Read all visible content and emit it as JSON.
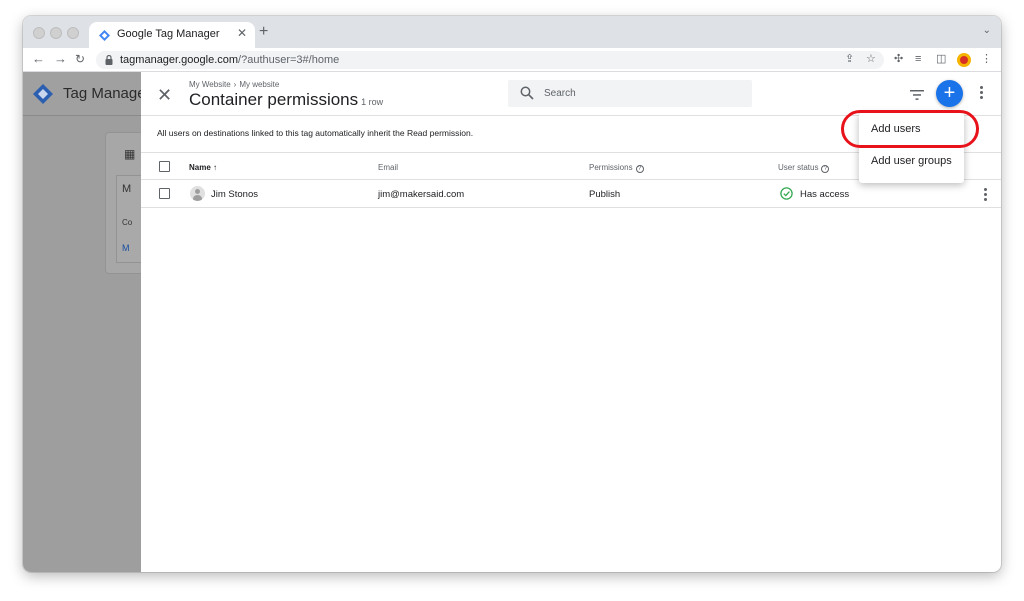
{
  "browser": {
    "tab_title": "Google Tag Manager",
    "url_host": "tagmanager.google.com",
    "url_rest": "/?authuser=3#/home"
  },
  "background": {
    "app_name": "Tag Manage",
    "card_letter": "M",
    "card_label": "Co",
    "card_link": "M"
  },
  "panel": {
    "breadcrumb": [
      "My Website",
      "My website"
    ],
    "title": "Container permissions",
    "row_count": "1 row",
    "search_placeholder": "Search",
    "notice": "All users on destinations linked to this tag automatically inherit the Read permission.",
    "columns": [
      "Name",
      "Email",
      "Permissions",
      "User status"
    ],
    "rows": [
      {
        "name": "Jim Stonos",
        "email": "jim@makersaid.com",
        "permission": "Publish",
        "status": "Has access"
      }
    ]
  },
  "add_menu": {
    "items": [
      "Add users",
      "Add user groups"
    ]
  },
  "colors": {
    "accent": "#1a73e8",
    "highlight": "#e8121b",
    "status_ok": "#34a853"
  }
}
